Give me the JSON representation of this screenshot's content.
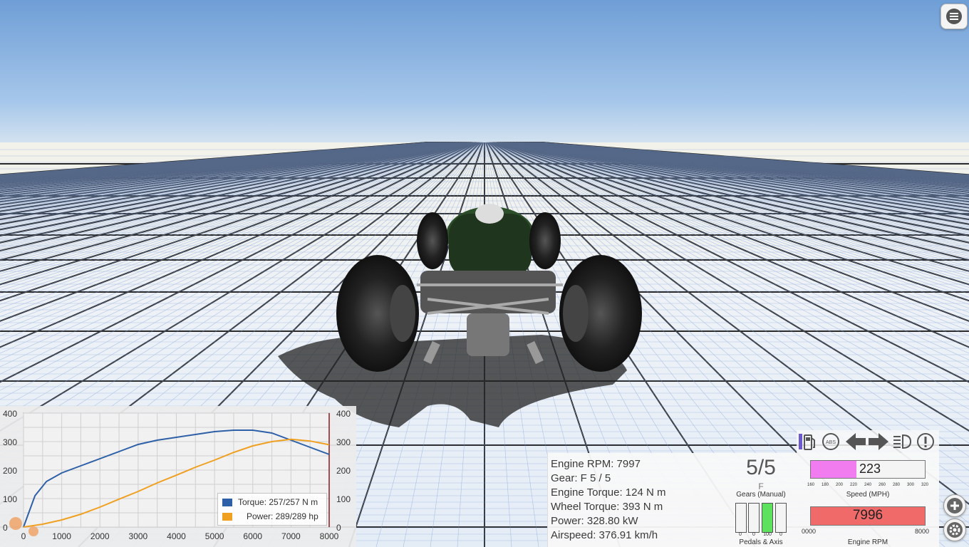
{
  "app": {
    "menu_icon": "hamburger-menu-icon"
  },
  "graph": {
    "legend": {
      "torque_label": "Torque: 257/257 N m",
      "power_label": "Power: 289/289 hp",
      "torque_color": "#2e60a8",
      "power_color": "#f0a020"
    }
  },
  "chart_data": {
    "type": "line",
    "x_ticks": [
      "0",
      "1000",
      "2000",
      "3000",
      "4000",
      "5000",
      "6000",
      "7000",
      "8000"
    ],
    "y_left_ticks": [
      "400",
      "300",
      "200",
      "100",
      "0"
    ],
    "y_right_ticks": [
      "400",
      "300",
      "200",
      "100",
      "0"
    ],
    "xlim": [
      0,
      8000
    ],
    "ylim": [
      0,
      400
    ],
    "series": [
      {
        "name": "Torque",
        "color": "#2e60a8",
        "x": [
          0,
          300,
          600,
          1000,
          1500,
          2000,
          2500,
          3000,
          3500,
          4000,
          4500,
          5000,
          5500,
          6000,
          6500,
          7000,
          7500,
          8000
        ],
        "y": [
          0,
          110,
          160,
          190,
          215,
          240,
          265,
          290,
          305,
          315,
          325,
          335,
          340,
          340,
          330,
          305,
          280,
          255
        ]
      },
      {
        "name": "Power",
        "color": "#f0a020",
        "x": [
          0,
          500,
          1000,
          1500,
          2000,
          2500,
          3000,
          3500,
          4000,
          4500,
          5000,
          5500,
          6000,
          6500,
          7000,
          7500,
          8000
        ],
        "y": [
          0,
          10,
          25,
          45,
          70,
          98,
          125,
          155,
          182,
          210,
          235,
          262,
          285,
          300,
          308,
          302,
          289
        ]
      }
    ]
  },
  "debug": {
    "lines": [
      "Engine RPM: 7997",
      "Gear: F 5 / 5",
      "Engine Torque: 124 N m",
      "Wheel Torque: 393 N m",
      "Power: 328.80 kW",
      "Airspeed: 376.91 km/h"
    ]
  },
  "dash": {
    "gear_display": "5/5",
    "gear_mode": "F",
    "gear_label": "Gears (Manual)",
    "pedals": [
      {
        "value": "0",
        "fill": 0
      },
      {
        "value": "0",
        "fill": 0
      },
      {
        "value": "100",
        "fill": 1
      },
      {
        "value": "0",
        "fill": 0
      }
    ],
    "pedals_label": "Pedals & Axis",
    "speed_value": "223",
    "speed_fill": 0.4,
    "speed_ticks": [
      "160",
      "180",
      "200",
      "220",
      "240",
      "260",
      "280",
      "300",
      "320"
    ],
    "speed_label": "Speed (MPH)",
    "rpm_value": "7996",
    "rpm_fill": 1.0,
    "rpm_min": "0000",
    "rpm_max": "8000",
    "rpm_label": "Engine RPM",
    "indicators": [
      "fuel-icon",
      "abs-icon",
      "left-signal-icon",
      "right-signal-icon",
      "headlight-icon",
      "warning-icon"
    ],
    "buttons": [
      "add-icon",
      "settings-icon"
    ]
  }
}
